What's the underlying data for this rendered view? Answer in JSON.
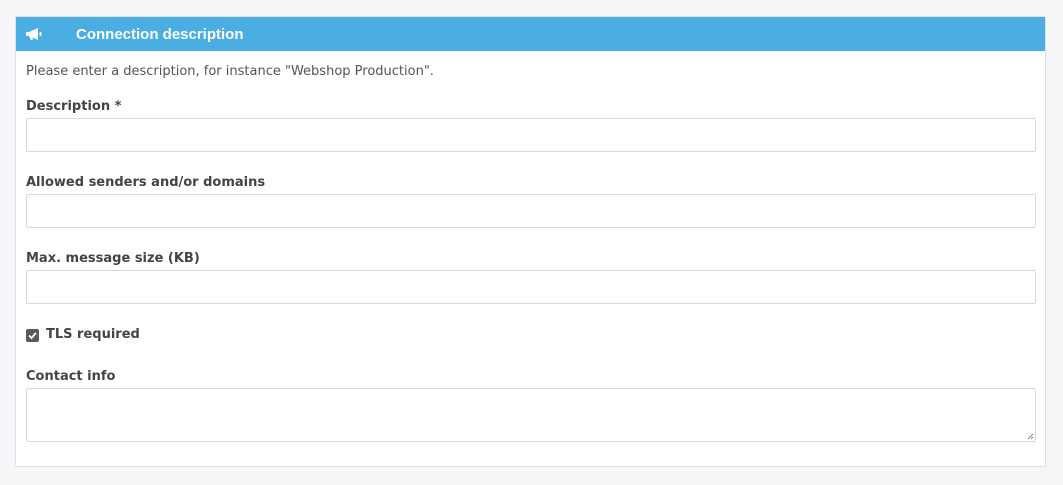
{
  "panel": {
    "icon": "megaphone-icon",
    "title": "Connection description",
    "intro": "Please enter a description, for instance \"Webshop Production\"."
  },
  "fields": {
    "description": {
      "label": "Description *",
      "value": ""
    },
    "allowed_senders": {
      "label": "Allowed senders and/or domains",
      "value": ""
    },
    "max_message_size": {
      "label": "Max. message size (KB)",
      "value": ""
    },
    "tls_required": {
      "label": "TLS required",
      "checked": true
    },
    "contact_info": {
      "label": "Contact info",
      "value": ""
    }
  },
  "colors": {
    "header": "#4aaee3",
    "background": "#f5f6f8"
  }
}
